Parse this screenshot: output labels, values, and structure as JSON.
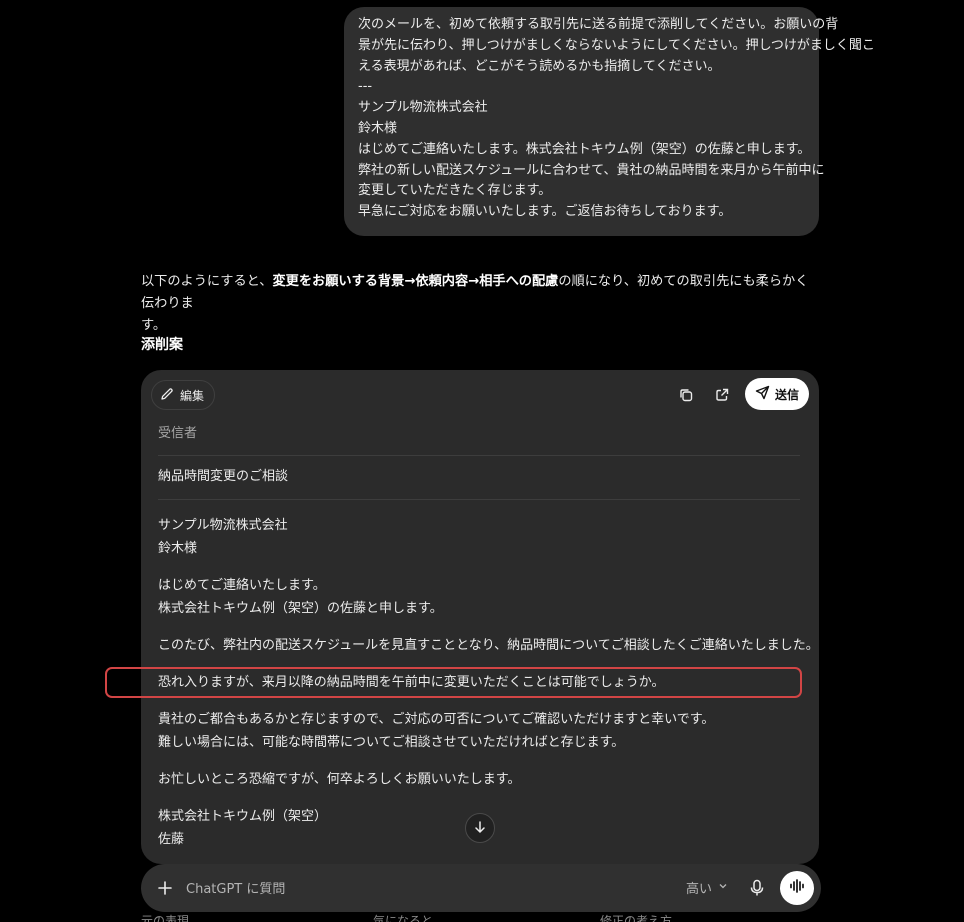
{
  "user_message": {
    "lines": [
      "次のメールを、初めて依頼する取引先に送る前提で添削してください。お願いの背",
      "景が先に伝わり、押しつけがましくならないようにしてください。押しつけがましく聞こ",
      "える表現があれば、どこがそう読めるかも指摘してください。",
      "---",
      "サンプル物流株式会社",
      "鈴木様",
      "はじめてご連絡いたします。株式会社トキウム例（架空）の佐藤と申します。",
      "弊社の新しい配送スケジュールに合わせて、貴社の納品時間を来月から午前中に",
      "変更していただきたく存じます。",
      "早急にご対応をお願いいたします。ご返信お待ちしております。"
    ]
  },
  "response": {
    "intro_prefix": "以下のようにすると、",
    "intro_bold": "変更をお願いする背景→依頼内容→相手への配慮",
    "intro_suffix": "の順になり、初めての取引先にも柔らかく伝わりま",
    "intro_line2": "す。",
    "section_title": "添削案"
  },
  "email_card": {
    "edit_label": "編集",
    "send_label": "送信",
    "recipient_label": "受信者",
    "subject": "納品時間変更のご相談",
    "body": {
      "p1": [
        "サンプル物流株式会社",
        "鈴木様"
      ],
      "p2": [
        "はじめてご連絡いたします。",
        "株式会社トキウム例（架空）の佐藤と申します。"
      ],
      "p3": [
        "このたび、弊社内の配送スケジュールを見直すこととなり、納品時間についてご相談したくご連絡いたしました。"
      ],
      "p4": [
        "恐れ入りますが、来月以降の納品時間を午前中に変更いただくことは可能でしょうか。"
      ],
      "p5": [
        "貴社のご都合もあるかと存じますので、ご対応の可否についてご確認いただけますと幸いです。",
        "難しい場合には、可能な時間帯についてご相談させていただければと存じます。"
      ],
      "p6": [
        "お忙しいところ恐縮ですが、何卒よろしくお願いいたします。"
      ],
      "p7": [
        "株式会社トキウム例（架空）",
        "佐藤"
      ]
    }
  },
  "composer": {
    "placeholder": "ChatGPT に質問",
    "model_label": "高い"
  },
  "cut_off_text": [
    "元の表現",
    "気になると",
    "修正の考え方"
  ],
  "colors": {
    "background": "#000000",
    "bubble": "#2f2f2f",
    "card": "#2b2b2b",
    "highlight": "#d24545"
  }
}
